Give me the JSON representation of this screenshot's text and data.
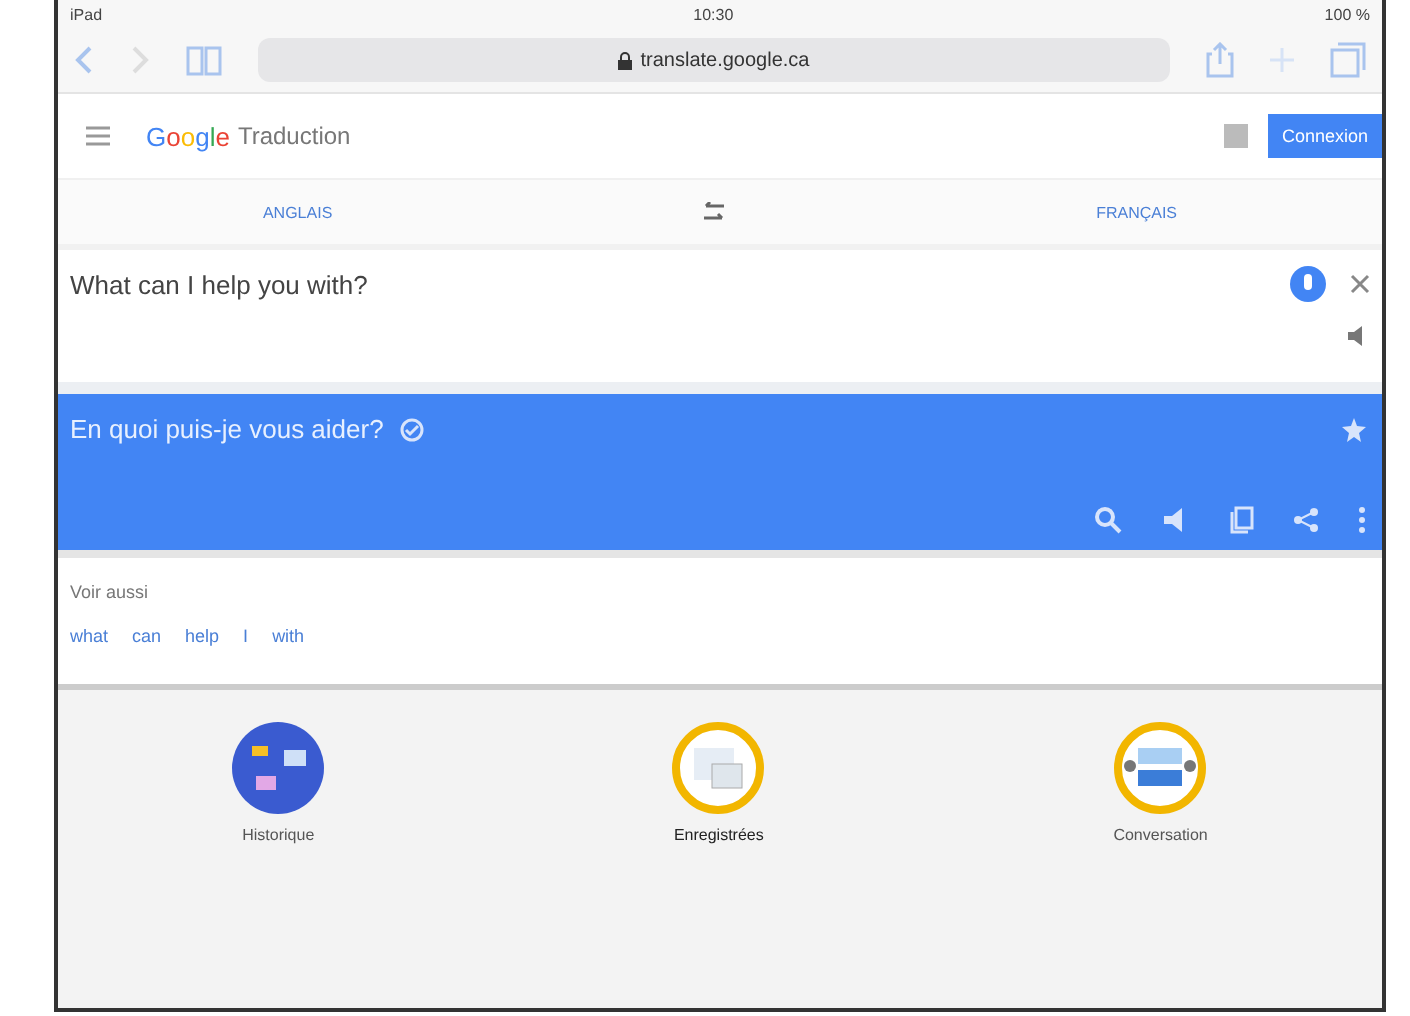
{
  "status_bar": {
    "device": "iPad",
    "time": "10:30",
    "battery": "100 %"
  },
  "browser": {
    "url": "translate.google.ca"
  },
  "header": {
    "logo": "Google",
    "title": "Traduction",
    "sign_in": "Connexion"
  },
  "languages": {
    "source": "ANGLAIS",
    "target": "FRANÇAIS"
  },
  "input": {
    "text": "What can I help you with?"
  },
  "output": {
    "text": "En quoi puis-je vous aider?"
  },
  "see_also": {
    "label": "Voir aussi",
    "words": [
      "what",
      "can",
      "help",
      "I",
      "with"
    ]
  },
  "shortcuts": [
    {
      "label": "Historique",
      "kind": "history"
    },
    {
      "label": "Enregistrées",
      "kind": "saved"
    },
    {
      "label": "Conversation",
      "kind": "conversation"
    }
  ]
}
